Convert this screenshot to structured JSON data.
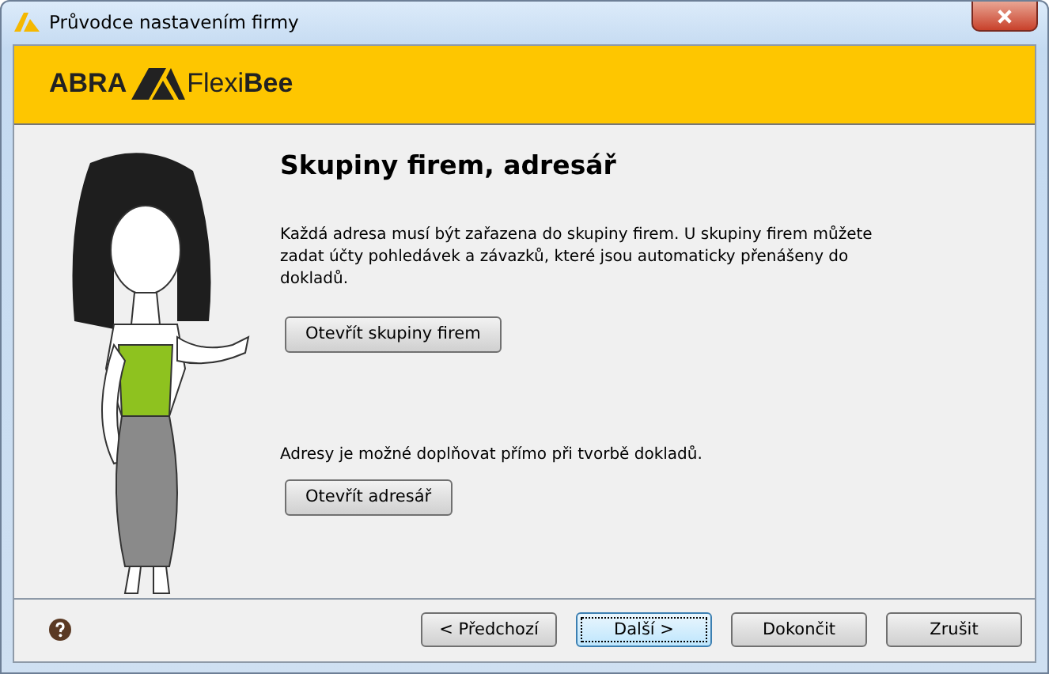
{
  "window": {
    "title": "Průvodce nastavením firmy"
  },
  "logo": {
    "left": "ABRA",
    "right": "Flexi**Bee**"
  },
  "page": {
    "heading": "Skupiny firem, adresář",
    "sections": [
      {
        "text": "Každá adresa musí být zařazena do skupiny firem. U skupiny firem můžete zadat účty pohledávek a závazků, které jsou automaticky přenášeny do dokladů.",
        "button": "Otevřít skupiny firem"
      },
      {
        "text": "Adresy je možné doplňovat přímo při tvorbě dokladů.",
        "button": "Otevřít adresář"
      }
    ]
  },
  "footer": {
    "buttons": [
      {
        "label": "< Předchozí",
        "focused": false
      },
      {
        "label": "Další >",
        "focused": true
      },
      {
        "label": "Dokončit",
        "focused": false
      },
      {
        "label": "Zrušit",
        "focused": false
      }
    ]
  }
}
